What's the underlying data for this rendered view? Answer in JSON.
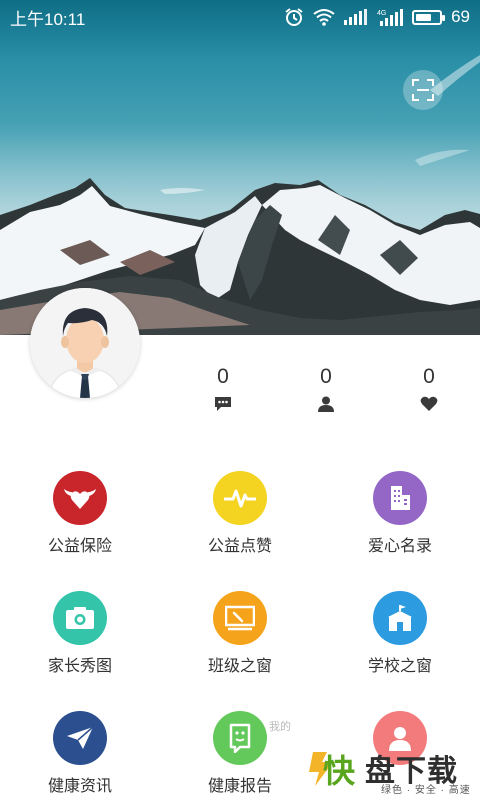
{
  "status_bar": {
    "time": "上午10:11",
    "battery_level": 69,
    "battery_percent": "69",
    "icons": [
      "alarm-icon",
      "wifi-icon",
      "signal-icon",
      "signal-4g-icon",
      "battery-icon"
    ]
  },
  "header": {
    "scan_icon": "scan-icon"
  },
  "profile": {
    "avatar_icon": "default-avatar-icon",
    "stats": [
      {
        "value": "0",
        "icon": "message-icon"
      },
      {
        "value": "0",
        "icon": "person-icon"
      },
      {
        "value": "0",
        "icon": "heart-icon"
      }
    ]
  },
  "menu": {
    "items": [
      {
        "label": "公益保险",
        "icon": "heart-wings-icon",
        "color": "#c9262c"
      },
      {
        "label": "公益点赞",
        "icon": "pulse-icon",
        "color": "#f4d321"
      },
      {
        "label": "爱心名录",
        "icon": "building-icon",
        "color": "#9467c7"
      },
      {
        "label": "家长秀图",
        "icon": "camera-icon",
        "color": "#33c4a9"
      },
      {
        "label": "班级之窗",
        "icon": "blackboard-icon",
        "color": "#f5a31b"
      },
      {
        "label": "学校之窗",
        "icon": "school-icon",
        "color": "#2d9be0"
      },
      {
        "label": "健康资讯",
        "icon": "paper-plane-icon",
        "color": "#2c4f8f"
      },
      {
        "label": "健康报告",
        "icon": "smile-card-icon",
        "color": "#62c95a"
      },
      {
        "label": "",
        "icon": "user-icon",
        "color": "#f37b7b"
      }
    ]
  },
  "watermark": {
    "brand_char": "快",
    "brand_text": "盘下载",
    "tagline": "绿色 · 安全 · 高速",
    "caption": "我的"
  }
}
